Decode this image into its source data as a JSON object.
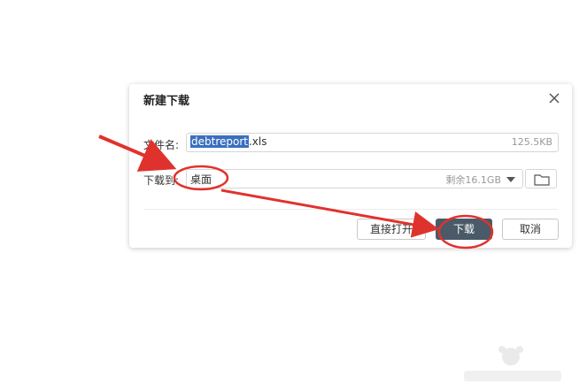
{
  "dialog": {
    "title": "新建下载",
    "filename_label": "文件名:",
    "filename_selected": "debtreport",
    "filename_ext": ".xls",
    "file_size": "125.5KB",
    "saveto_label": "下载到:",
    "saveto_value": "桌面",
    "free_space": "剩余16.1GB",
    "buttons": {
      "open": "直接打开",
      "download": "下载",
      "cancel": "取消"
    }
  },
  "colors": {
    "primary_button": "#4a5a68",
    "selection": "#3a6fbf",
    "annotation": "#e0322d"
  },
  "icons": [
    "close-icon",
    "folder-icon",
    "dropdown-caret-icon"
  ]
}
